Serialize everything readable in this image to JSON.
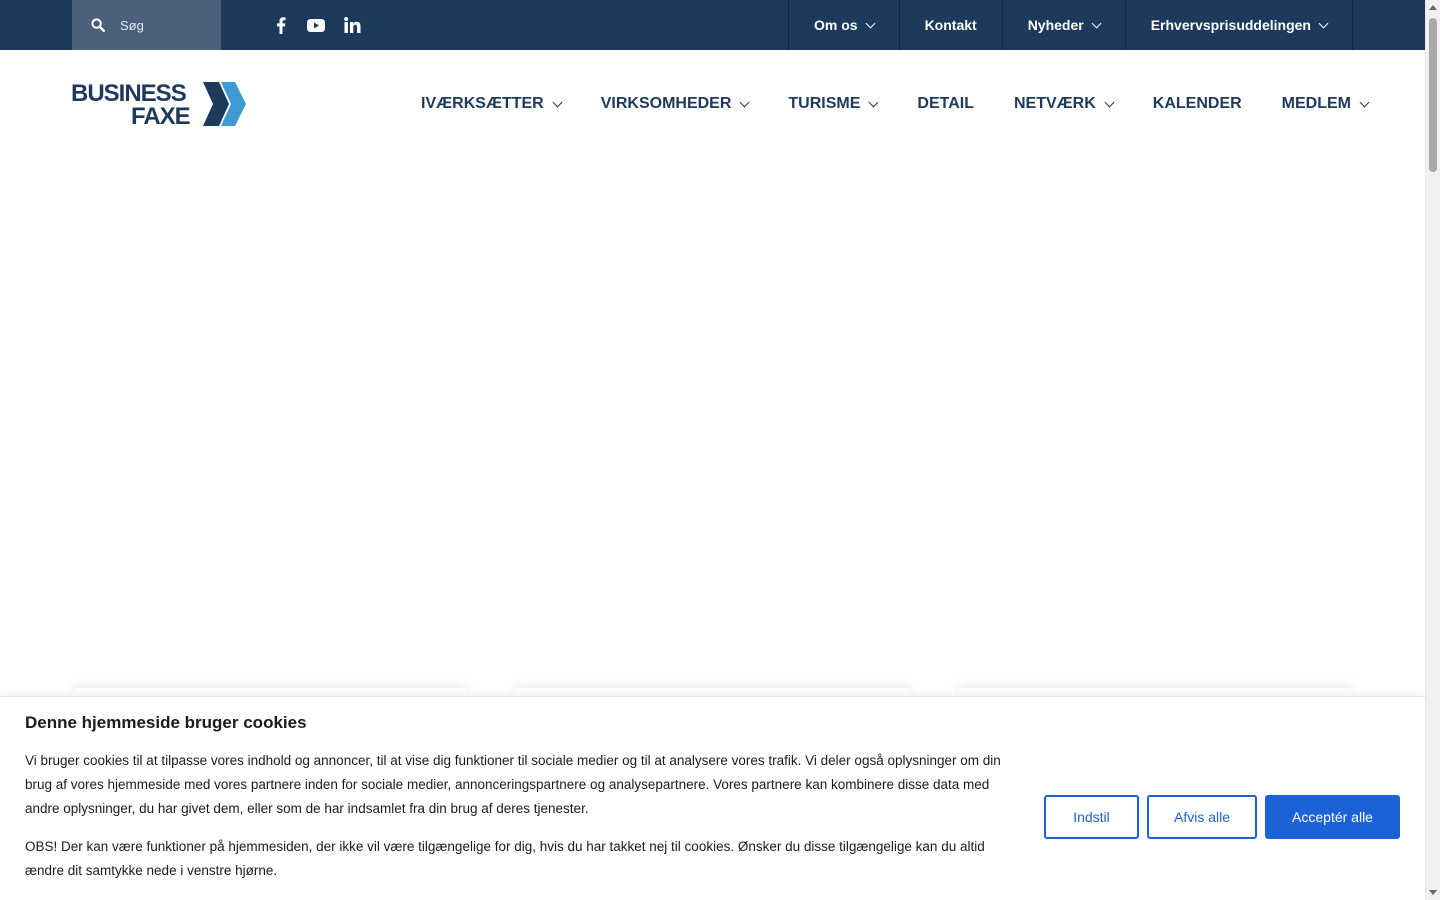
{
  "topbar": {
    "search_placeholder": "Søg",
    "social": [
      "facebook-icon",
      "youtube-icon",
      "linkedin-icon"
    ],
    "nav": [
      {
        "label": "Om os",
        "dropdown": true
      },
      {
        "label": "Kontakt",
        "dropdown": false
      },
      {
        "label": "Nyheder",
        "dropdown": true
      },
      {
        "label": "Erhvervsprisuddelingen",
        "dropdown": true
      }
    ]
  },
  "logo": {
    "line1": "BUSINESS",
    "line2": "FAXE"
  },
  "mainnav": [
    {
      "label": "IVÆRKSÆTTER",
      "dropdown": true
    },
    {
      "label": "VIRKSOMHEDER",
      "dropdown": true
    },
    {
      "label": "TURISME",
      "dropdown": true
    },
    {
      "label": "DETAIL",
      "dropdown": false
    },
    {
      "label": "NETVÆRK",
      "dropdown": true
    },
    {
      "label": "KALENDER",
      "dropdown": false
    },
    {
      "label": "MEDLEM",
      "dropdown": true
    }
  ],
  "cookie": {
    "title": "Denne hjemmeside bruger cookies",
    "text1": "Vi bruger cookies til at tilpasse vores indhold og annoncer, til at vise dig funktioner til sociale medier og til at analysere vores trafik. Vi deler også oplysninger om din brug af vores hjemmeside med vores partnere inden for sociale medier, annonceringspartnere og analysepartnere. Vores partnere kan kombinere disse data med andre oplysninger, du har givet dem, eller som de har indsamlet fra din brug af deres tjenester.",
    "text2": "OBS! Der kan være funktioner på hjemmesiden, der ikke vil være tilgængelige for dig, hvis du har takket nej til cookies. Ønsker du disse tilgængelige kan du altid ændre dit samtykke nede i venstre hjørne.",
    "btn_settings": "Indstil",
    "btn_reject": "Afvis alle",
    "btn_accept": "Acceptér alle"
  },
  "colors": {
    "topbar": "#1d3a5c",
    "search_bg": "#4c607c",
    "brand_dark": "#1d3a5c",
    "brand_light": "#3f9ad3",
    "button_blue": "#1a62d6"
  }
}
